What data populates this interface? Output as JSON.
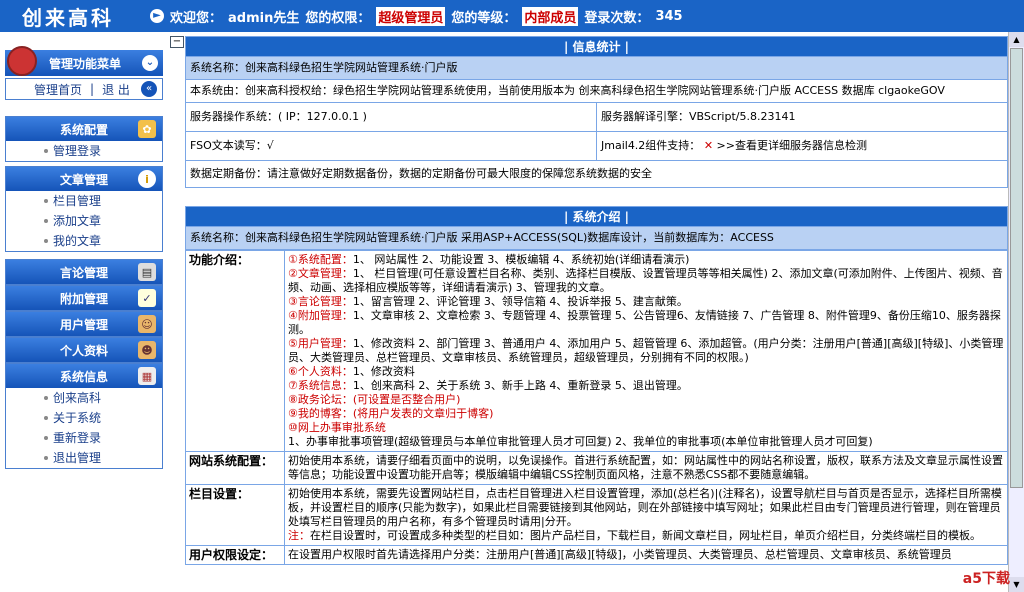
{
  "header": {
    "logo": "创来高科",
    "welcome": "欢迎您：",
    "user": "admin先生",
    "perm_label": "您的权限：",
    "perm": "超级管理员",
    "level_label": "您的等级：",
    "level": "内部成员",
    "login_label": "登录次数：",
    "login_count": "345"
  },
  "sidebar": {
    "menu_title": "管理功能菜单",
    "home": "管理首页",
    "sep": "|",
    "logout": "退 出",
    "groups": [
      {
        "label": "系统配置",
        "items": [
          "管理登录"
        ]
      },
      {
        "label": "文章管理",
        "items": [
          "栏目管理",
          "添加文章",
          "我的文章"
        ]
      },
      {
        "label": "言论管理",
        "items": []
      },
      {
        "label": "附加管理",
        "items": []
      },
      {
        "label": "用户管理",
        "items": []
      },
      {
        "label": "个人资料",
        "items": []
      },
      {
        "label": "系统信息",
        "items": [
          "创来高科",
          "关于系统",
          "重新登录",
          "退出管理"
        ]
      }
    ]
  },
  "info": {
    "title": "| 信息统计 |",
    "sysname": "系统名称：创来高科绿色招生学院网站管理系统·门户版",
    "auth": "本系统由：创来高科授权给：绿色招生学院网站管理系统使用，当前使用版本为 创来高科绿色招生学院网站管理系统·门户版  ACCESS 数据库 clgaokeGOV",
    "os": "服务器操作系统：( IP：127.0.0.1 )",
    "engine": "服务器解译引擎：VBScript/5.8.23141",
    "fso": "FSO文本读写：√",
    "jmail": "Jmail4.2组件支持：",
    "jmail_x": "✕",
    "detect": ">>查看更详细服务器信息检测",
    "backup": "数据定期备份：请注意做好定期数据备份，数据的定期备份可最大限度的保障您系统数据的安全"
  },
  "intro": {
    "title": "| 系统介绍 |",
    "sysname": "系统名称：创来高科绿色招生学院网站管理系统·门户版 采用ASP+ACCESS(SQL)数据库设计，当前数据库为：ACCESS",
    "rows": [
      {
        "key": "功能介绍：",
        "lines": [
          {
            "n": "①",
            "h": "系统配置：",
            "t": "1、 网站属性 2、功能设置 3、模板编辑 4、系统初始(详细请看演示)"
          },
          {
            "n": "②",
            "h": "文章管理：",
            "t": "1、 栏目管理(可任意设置栏目名称、类别、选择栏目模版、设置管理员等等相关属性) 2、添加文章(可添加附件、上传图片、视频、音频、动画、选择相应模版等等，详细请看演示) 3、管理我的文章。"
          },
          {
            "n": "③",
            "h": "言论管理：",
            "t": "1、留言管理 2、评论管理 3、领导信箱 4、投诉举报 5、建言献策。"
          },
          {
            "n": "④",
            "h": "附加管理：",
            "t": "1、文章审核 2、文章检索 3、专题管理 4、投票管理 5、公告管理6、友情链接 7、广告管理 8、附件管理9、备份压缩10、服务器探测。"
          },
          {
            "n": "⑤",
            "h": "用户管理：",
            "t": "1、修改资料 2、部门管理 3、普通用户 4、添加用户 5、超管管理 6、添加超管。(用户分类：注册用户[普通][高级][特级]、小类管理员、大类管理员、总栏管理员、文章审核员、系统管理员，超级管理员，分别拥有不同的权限。)"
          },
          {
            "n": "⑥",
            "h": "个人资料：",
            "t": "1、修改资料"
          },
          {
            "n": "⑦",
            "h": "系统信息：",
            "t": "1、创来高科 2、关于系统 3、新手上路 4、重新登录 5、退出管理。"
          },
          {
            "n": "⑧",
            "h": "政务论坛：",
            "t": "(可设置是否整合用户)",
            "all": true
          },
          {
            "n": "⑨",
            "h": "我的博客：",
            "t": "(将用户发表的文章归于博客)",
            "all": true
          },
          {
            "n": "⑩",
            "h": "网上办事审批系统",
            "t": ""
          },
          {
            "n": "",
            "h": "",
            "t": "1、办事审批事项管理(超级管理员与本单位审批管理人员才可回复) 2、我单位的审批事项(本单位审批管理人员才可回复)"
          }
        ]
      },
      {
        "key": "网站系统配置：",
        "text": "初始使用本系统，请要仔细看页面中的说明，以免误操作。首进行系统配置，如：网站属性中的网站名称设置，版权，联系方法及文章显示属性设置等信息；功能设置中设置功能开启等；模版编辑中编辑CSS控制页面风格，注意不熟悉CSS都不要随意编辑。"
      },
      {
        "key": "栏目设置：",
        "text": "初始使用本系统，需要先设置网站栏目，点击栏目管理进入栏目设置管理，添加(总栏名)|(注释名)，设置导航栏目与首页是否显示，选择栏目所需模板，并设置栏目的顺序(只能为数字)，如果此栏目需要链接到其他网站，则在外部链接中填写网址；如果此栏目由专门管理员进行管理，则在管理员处填写栏目管理员的用户名称，有多个管理员时请用|分开。",
        "note_label": "注：",
        "note": "在栏目设置时，可设置成多种类型的栏目如：图片产品栏目，下载栏目，新闻文章栏目，网址栏目，单页介绍栏目，分类终端栏目的模板。"
      },
      {
        "key": "用户权限设定：",
        "text": "在设置用户权限时首先请选择用户分类：注册用户[普通][高级][特级]，小类管理员、大类管理员、总栏管理员、文章审核员、系统管理员"
      }
    ]
  },
  "watermark": "a5下载"
}
